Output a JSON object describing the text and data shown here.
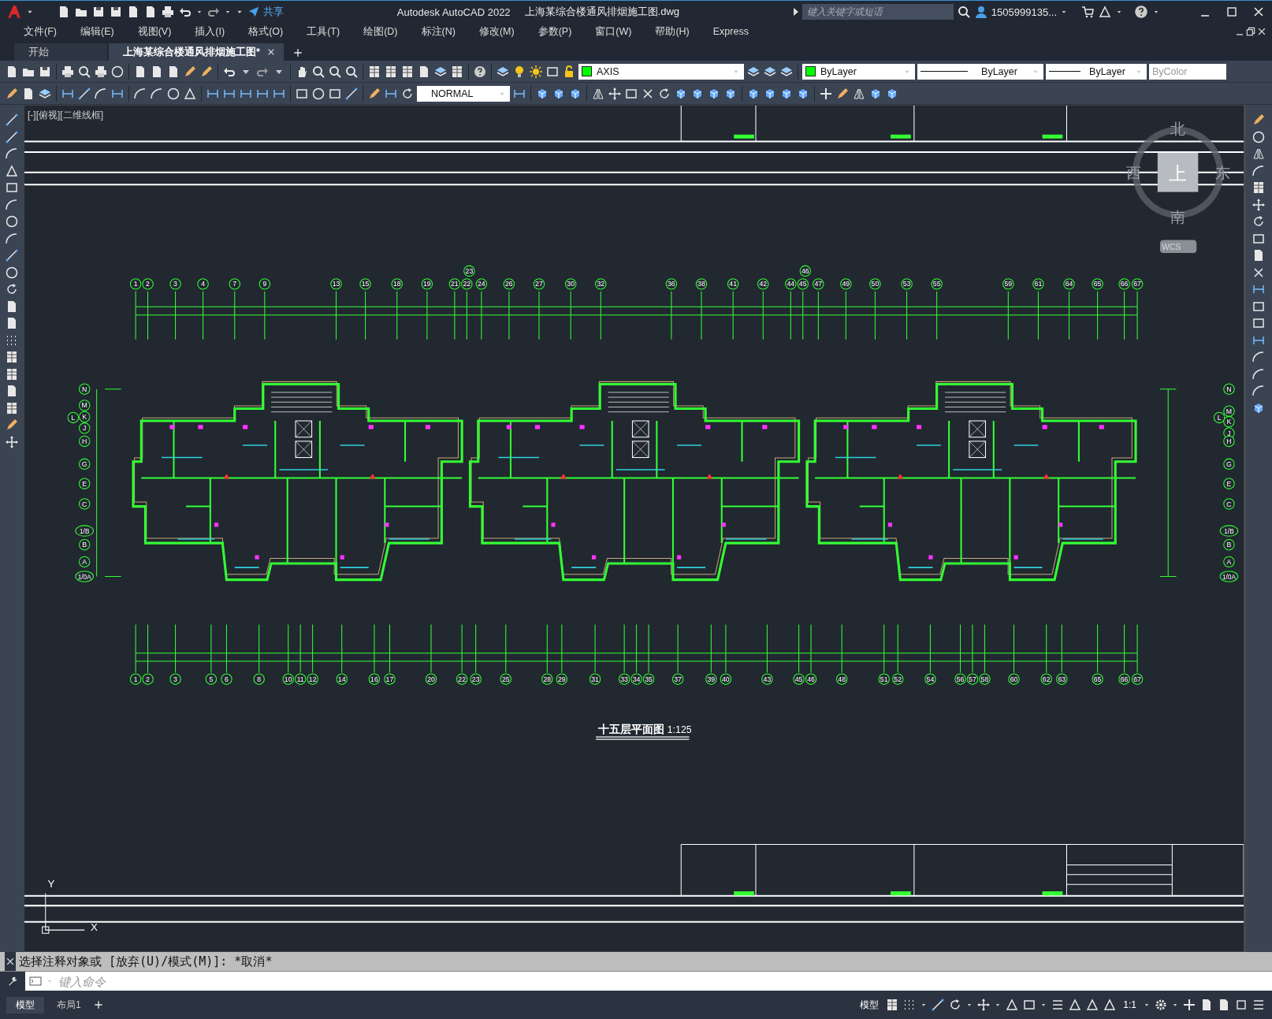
{
  "title_bar": {
    "share": "共享",
    "app_title": "Autodesk AutoCAD 2022",
    "file_name": "上海某综合楼通风排烟施工图.dwg",
    "search": {
      "placeholder": "键入关键字或短语"
    },
    "user": "1505999135..."
  },
  "menu": [
    "文件(F)",
    "编辑(E)",
    "视图(V)",
    "插入(I)",
    "格式(O)",
    "工具(T)",
    "绘图(D)",
    "标注(N)",
    "修改(M)",
    "参数(P)",
    "窗口(W)",
    "帮助(H)",
    "Express"
  ],
  "doc_tabs": [
    {
      "label": "开始",
      "selected": false
    },
    {
      "label": "上海某综合楼通风排烟施工图*",
      "selected": true
    }
  ],
  "properties": {
    "layer": "AXIS",
    "color_setting": "ByLayer",
    "linetype": "ByLayer",
    "lineweight": "ByLayer",
    "plot_style": "ByColor",
    "text_style": "NORMAL"
  },
  "viewport_label": "[-][俯视][二维线框]",
  "drawing": {
    "top_axes": [
      "1",
      "2",
      "3",
      "4",
      "7",
      "9",
      "13",
      "15",
      "18",
      "19",
      "21",
      "22",
      "24",
      "26",
      "27",
      "30",
      "32",
      "36",
      "38",
      "41",
      "42",
      "44",
      "45",
      "47",
      "49",
      "50",
      "53",
      "55",
      "59",
      "61",
      "64",
      "65",
      "66",
      "67"
    ],
    "top_axes_upper": [
      "23",
      "46"
    ],
    "bottom_axes": [
      "1",
      "2",
      "3",
      "5",
      "6",
      "8",
      "10",
      "11",
      "12",
      "14",
      "16",
      "17",
      "20",
      "22",
      "23",
      "25",
      "28",
      "29",
      "31",
      "33",
      "34",
      "35",
      "37",
      "39",
      "40",
      "43",
      "45",
      "46",
      "48",
      "51",
      "52",
      "54",
      "56",
      "57",
      "58",
      "60",
      "62",
      "63",
      "65",
      "66",
      "67"
    ],
    "left_axes": [
      "N",
      "M",
      "L",
      "K",
      "J",
      "H",
      "G",
      "E",
      "C",
      "1/B",
      "B",
      "A",
      "1/0A"
    ],
    "right_axes": [
      "N",
      "M",
      "L",
      "K",
      "J",
      "H",
      "G",
      "E",
      "C",
      "1/B",
      "B",
      "A",
      "1/0A"
    ],
    "title": "十五层平面图",
    "scale": "1:125"
  },
  "viewcube": {
    "north": "北",
    "west": "西",
    "face": "上",
    "east": "东",
    "south": "南",
    "ucs": "WCS"
  },
  "ucs_icon": {
    "y": "Y",
    "x": "X"
  },
  "command": {
    "history": "选择注释对象或 [放弃(U)/模式(M)]: *取消*",
    "placeholder": "键入命令"
  },
  "layout_tabs": [
    {
      "label": "模型",
      "selected": true
    },
    {
      "label": "布局1",
      "selected": false
    }
  ],
  "status_bar": {
    "space": "模型",
    "scale": "1:1"
  }
}
